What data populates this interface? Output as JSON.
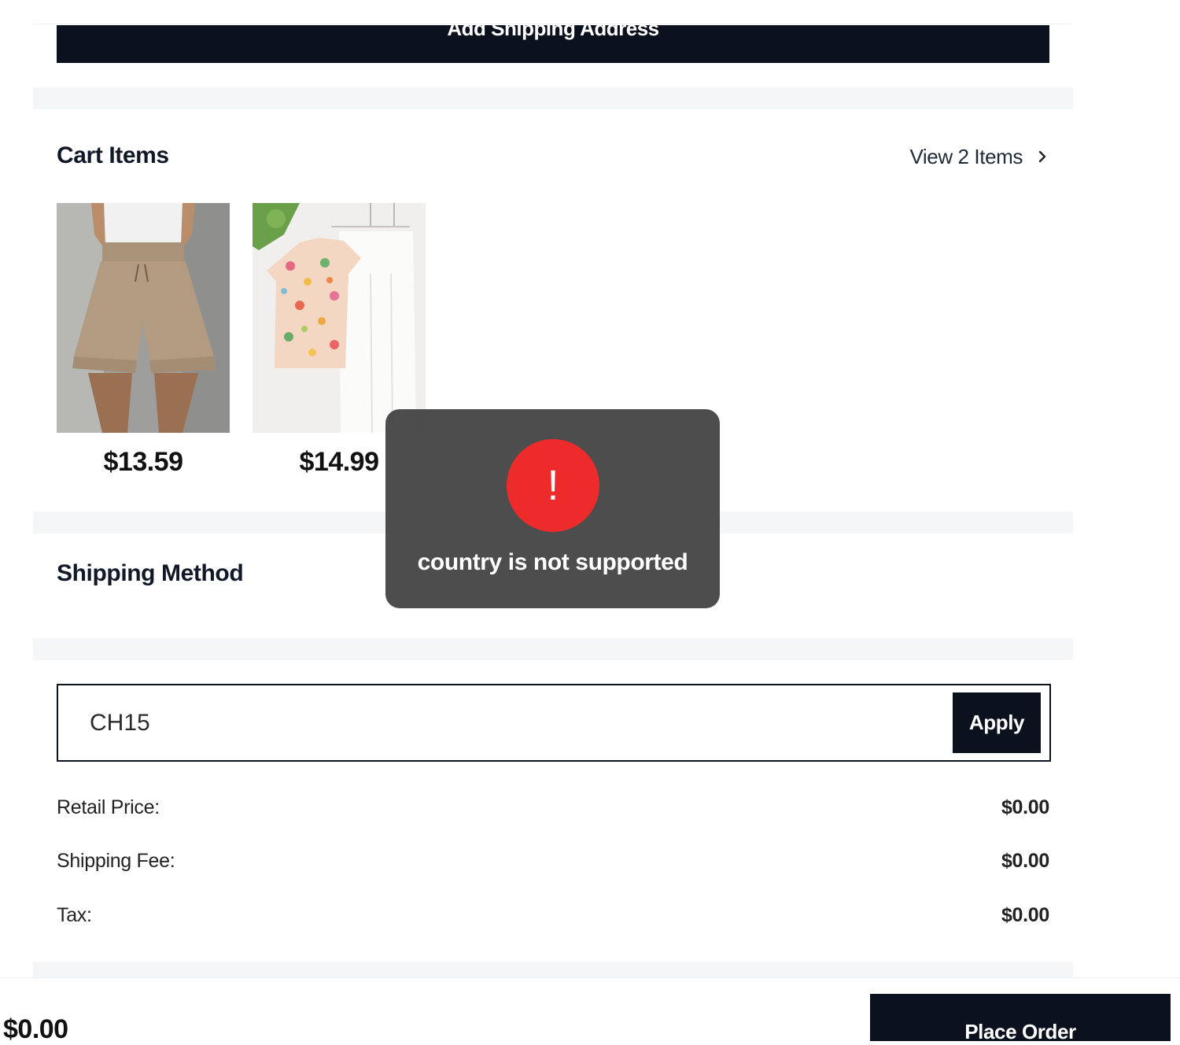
{
  "shipping": {
    "add_address_label": "Add Shipping Address"
  },
  "cart": {
    "title": "Cart Items",
    "view_items_label": "View 2 Items",
    "items": [
      {
        "price": "$13.59",
        "image": "khaki-drawstring-shorts"
      },
      {
        "price": "$14.99",
        "image": "floral-top-white-pants-set"
      }
    ]
  },
  "shipping_method": {
    "title": "Shipping Method"
  },
  "coupon": {
    "value": "CH15",
    "apply_label": "Apply"
  },
  "summary": {
    "rows": [
      {
        "label": "Retail Price:",
        "value": "$0.00"
      },
      {
        "label": "Shipping Fee:",
        "value": "$0.00"
      },
      {
        "label": "Tax:",
        "value": "$0.00"
      }
    ]
  },
  "footer": {
    "total": "$0.00",
    "place_order_label": "Place Order"
  },
  "toast": {
    "icon": "exclamation-icon",
    "icon_glyph": "!",
    "message": "country is not supported"
  },
  "colors": {
    "primary": "#0b111d",
    "error": "#ee2b2b",
    "toast_bg": "#404040",
    "divider": "#f5f6f8"
  }
}
